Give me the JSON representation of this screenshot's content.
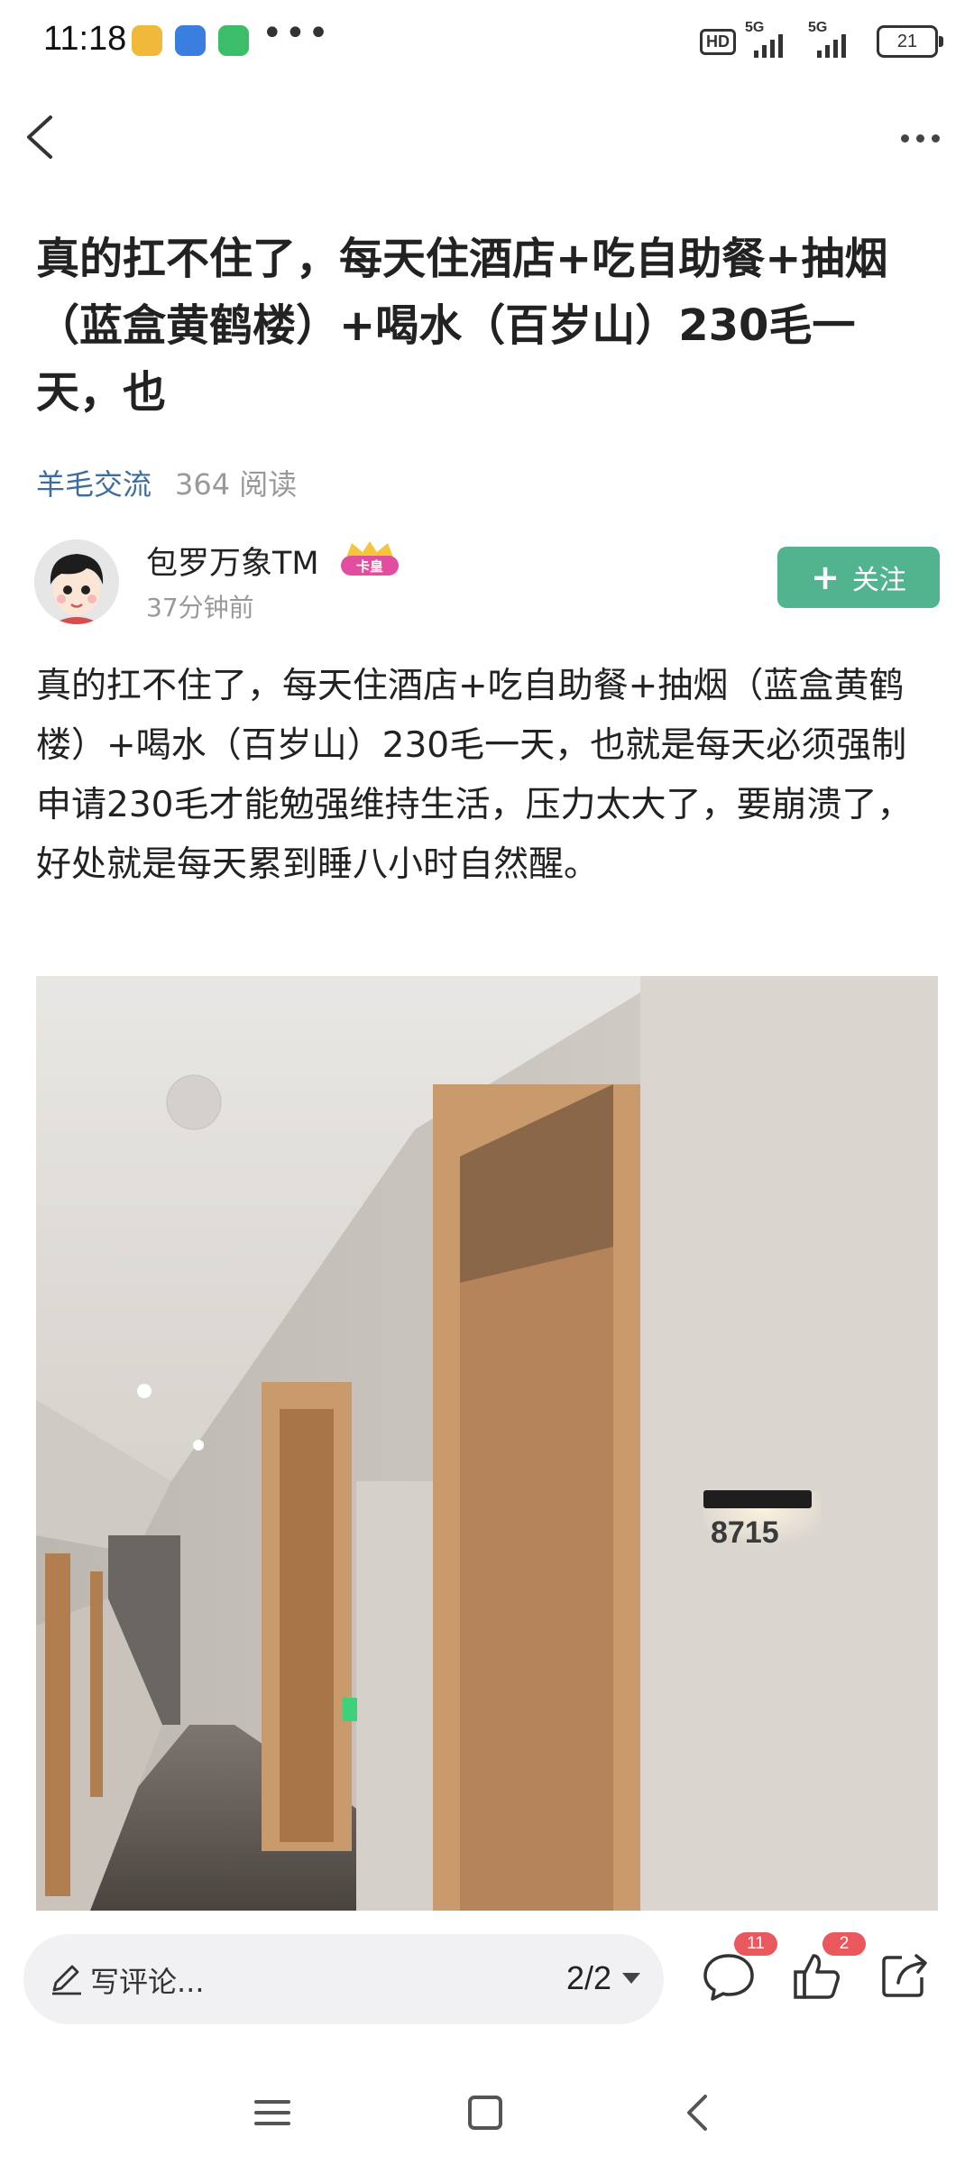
{
  "status_bar": {
    "time": "11:18",
    "more_indicator": "•••",
    "hd_label": "HD",
    "signal_1_label": "5G",
    "signal_2_label": "5G",
    "battery": "21",
    "app_icons": [
      {
        "name": "notes-app-icon",
        "color": "#f0b93a"
      },
      {
        "name": "calendar-app-icon",
        "color": "#3a7ee0"
      },
      {
        "name": "security-app-icon",
        "color": "#3bbd6a"
      }
    ]
  },
  "nav": {
    "back_icon": "chevron-left-icon",
    "more_icon": "more-horizontal-icon"
  },
  "post": {
    "title": "真的扛不住了，每天住酒店+吃自助餐+抽烟（蓝盒黄鹤楼）+喝水（百岁山）230毛一天，也",
    "category": "羊毛交流",
    "read_count": "364 阅读",
    "author": {
      "name": "包罗万象TM",
      "badge": "卡皇",
      "time": "37分钟前"
    },
    "follow_label": "关注",
    "body": "真的扛不住了，每天住酒店+吃自助餐+抽烟（蓝盒黄鹤楼）+喝水（百岁山）230毛一天，也就是每天必须强制申请230毛才能勉强维持生活，压力太大了，要崩溃了，好处就是每天累到睡八小时自然醒。",
    "image": {
      "room_number": "8715"
    }
  },
  "bottom_bar": {
    "comment_placeholder": "写评论...",
    "page_indicator": "2/2",
    "comment_count": "11",
    "like_count": "2"
  },
  "colors": {
    "accent_green": "#52b38f",
    "link_blue": "#3d6d9c",
    "badge_red": "#e8585c"
  }
}
